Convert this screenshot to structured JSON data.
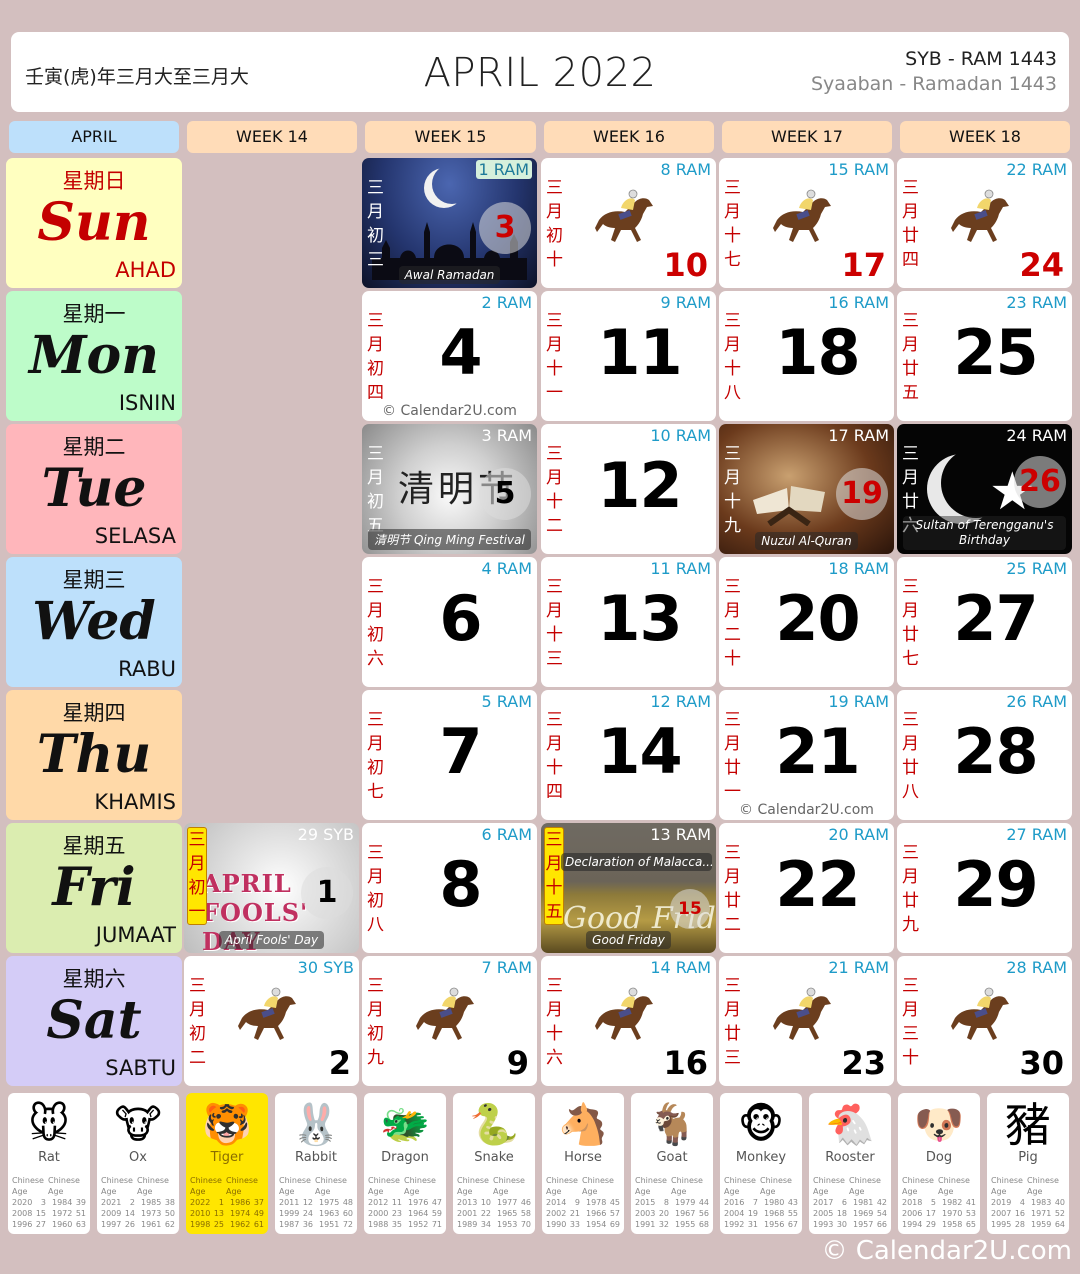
{
  "header": {
    "lunar_year": "壬寅(虎)年三月大至三月大",
    "title": "APRIL 2022",
    "hijri_short": "SYB - RAM 1443",
    "hijri_long": "Syaaban - Ramadan 1443"
  },
  "columns": [
    "APRIL",
    "WEEK 14",
    "WEEK 15",
    "WEEK 16",
    "WEEK 17",
    "WEEK 18"
  ],
  "days": [
    {
      "zh": "星期日",
      "en": "Sun",
      "ms": "AHAD",
      "bg": "#ffffc0"
    },
    {
      "zh": "星期一",
      "en": "Mon",
      "ms": "ISNIN",
      "bg": "#bdfcc9"
    },
    {
      "zh": "星期二",
      "en": "Tue",
      "ms": "SELASA",
      "bg": "#ffb6bb"
    },
    {
      "zh": "星期三",
      "en": "Wed",
      "ms": "RABU",
      "bg": "#bde0fb"
    },
    {
      "zh": "星期四",
      "en": "Thu",
      "ms": "KHAMIS",
      "bg": "#ffd9a8"
    },
    {
      "zh": "星期五",
      "en": "Fri",
      "ms": "JUMAAT",
      "bg": "#dbedb0"
    },
    {
      "zh": "星期六",
      "en": "Sat",
      "ms": "SABTU",
      "bg": "#d4ccf7"
    }
  ],
  "cells": {
    "d1": {
      "date": "1",
      "hijri": "29 SYB",
      "lunar": "三月初一",
      "event": "April Fools' Day",
      "art": "APRIL FOOLS' DAY"
    },
    "d2": {
      "date": "2",
      "hijri": "30 SYB",
      "lunar": "三月初二"
    },
    "d3": {
      "date": "3",
      "hijri": "1 RAM",
      "lunar": "三月初三",
      "event": "Awal Ramadan"
    },
    "d4": {
      "date": "4",
      "hijri": "2 RAM",
      "lunar": "三月初四",
      "watermark": "© Calendar2U.com"
    },
    "d5": {
      "date": "5",
      "hijri": "3 RAM",
      "lunar": "三月初五",
      "event": "清明节 Qing Ming Festival",
      "art": "清明节"
    },
    "d6": {
      "date": "6",
      "hijri": "4 RAM",
      "lunar": "三月初六"
    },
    "d7": {
      "date": "7",
      "hijri": "5 RAM",
      "lunar": "三月初七"
    },
    "d8": {
      "date": "8",
      "hijri": "6 RAM",
      "lunar": "三月初八"
    },
    "d9": {
      "date": "9",
      "hijri": "7 RAM",
      "lunar": "三月初九"
    },
    "d10": {
      "date": "10",
      "hijri": "8 RAM",
      "lunar": "三月初十"
    },
    "d11": {
      "date": "11",
      "hijri": "9 RAM",
      "lunar": "三月十一"
    },
    "d12": {
      "date": "12",
      "hijri": "10 RAM",
      "lunar": "三月十二"
    },
    "d13": {
      "date": "13",
      "hijri": "11 RAM",
      "lunar": "三月十三"
    },
    "d14": {
      "date": "14",
      "hijri": "12 RAM",
      "lunar": "三月十四"
    },
    "d15": {
      "date": "15",
      "hijri": "13 RAM",
      "lunar": "三月十五",
      "event": "Good Friday",
      "event2": "Declaration of Malacca...",
      "art": "Good Friday"
    },
    "d16": {
      "date": "16",
      "hijri": "14 RAM",
      "lunar": "三月十六"
    },
    "d17": {
      "date": "17",
      "hijri": "15 RAM",
      "lunar": "三月十七"
    },
    "d18": {
      "date": "18",
      "hijri": "16 RAM",
      "lunar": "三月十八"
    },
    "d19": {
      "date": "19",
      "hijri": "17 RAM",
      "lunar": "三月十九",
      "event": "Nuzul Al-Quran"
    },
    "d20": {
      "date": "20",
      "hijri": "18 RAM",
      "lunar": "三月二十"
    },
    "d21": {
      "date": "21",
      "hijri": "19 RAM",
      "lunar": "三月廿一",
      "watermark": "© Calendar2U.com"
    },
    "d22": {
      "date": "22",
      "hijri": "20 RAM",
      "lunar": "三月廿二"
    },
    "d23": {
      "date": "23",
      "hijri": "21 RAM",
      "lunar": "三月廿三"
    },
    "d24": {
      "date": "24",
      "hijri": "22 RAM",
      "lunar": "三月廿四"
    },
    "d25": {
      "date": "25",
      "hijri": "23 RAM",
      "lunar": "三月廿五"
    },
    "d26": {
      "date": "26",
      "hijri": "24 RAM",
      "lunar": "三月廿六",
      "event": "Sultan of Terengganu's Birthday"
    },
    "d27": {
      "date": "27",
      "hijri": "25 RAM",
      "lunar": "三月廿七"
    },
    "d28": {
      "date": "28",
      "hijri": "26 RAM",
      "lunar": "三月廿八"
    },
    "d29": {
      "date": "29",
      "hijri": "27 RAM",
      "lunar": "三月廿九"
    },
    "d30": {
      "date": "30",
      "hijri": "28 RAM",
      "lunar": "三月三十"
    }
  },
  "zodiac": {
    "col_headers": [
      "Chinese",
      "Age",
      "Chinese",
      "Age"
    ],
    "header_line1": [
      "Chinese",
      "Chinese"
    ],
    "header_line2": [
      "Age",
      "Age"
    ],
    "animals": [
      {
        "name": "Rat",
        "glyph": "🐭",
        "rows": [
          [
            "2020",
            "3",
            "1984",
            "39"
          ],
          [
            "2008",
            "15",
            "1972",
            "51"
          ],
          [
            "1996",
            "27",
            "1960",
            "63"
          ]
        ]
      },
      {
        "name": "Ox",
        "glyph": "🐮",
        "rows": [
          [
            "2021",
            "2",
            "1985",
            "38"
          ],
          [
            "2009",
            "14",
            "1973",
            "50"
          ],
          [
            "1997",
            "26",
            "1961",
            "62"
          ]
        ]
      },
      {
        "name": "Tiger",
        "glyph": "🐯",
        "highlight": true,
        "rows": [
          [
            "2022",
            "1",
            "1986",
            "37"
          ],
          [
            "2010",
            "13",
            "1974",
            "49"
          ],
          [
            "1998",
            "25",
            "1962",
            "61"
          ]
        ]
      },
      {
        "name": "Rabbit",
        "glyph": "🐰",
        "rows": [
          [
            "2011",
            "12",
            "1975",
            "48"
          ],
          [
            "1999",
            "24",
            "1963",
            "60"
          ],
          [
            "1987",
            "36",
            "1951",
            "72"
          ]
        ]
      },
      {
        "name": "Dragon",
        "glyph": "🐲",
        "rows": [
          [
            "2012",
            "11",
            "1976",
            "47"
          ],
          [
            "2000",
            "23",
            "1964",
            "59"
          ],
          [
            "1988",
            "35",
            "1952",
            "71"
          ]
        ]
      },
      {
        "name": "Snake",
        "glyph": "🐍",
        "rows": [
          [
            "2013",
            "10",
            "1977",
            "46"
          ],
          [
            "2001",
            "22",
            "1965",
            "58"
          ],
          [
            "1989",
            "34",
            "1953",
            "70"
          ]
        ]
      },
      {
        "name": "Horse",
        "glyph": "🐴",
        "rows": [
          [
            "2014",
            "9",
            "1978",
            "45"
          ],
          [
            "2002",
            "21",
            "1966",
            "57"
          ],
          [
            "1990",
            "33",
            "1954",
            "69"
          ]
        ]
      },
      {
        "name": "Goat",
        "glyph": "🐐",
        "rows": [
          [
            "2015",
            "8",
            "1979",
            "44"
          ],
          [
            "2003",
            "20",
            "1967",
            "56"
          ],
          [
            "1991",
            "32",
            "1955",
            "68"
          ]
        ]
      },
      {
        "name": "Monkey",
        "glyph": "🐵",
        "rows": [
          [
            "2016",
            "7",
            "1980",
            "43"
          ],
          [
            "2004",
            "19",
            "1968",
            "55"
          ],
          [
            "1992",
            "31",
            "1956",
            "67"
          ]
        ]
      },
      {
        "name": "Rooster",
        "glyph": "🐔",
        "rows": [
          [
            "2017",
            "6",
            "1981",
            "42"
          ],
          [
            "2005",
            "18",
            "1969",
            "54"
          ],
          [
            "1993",
            "30",
            "1957",
            "66"
          ]
        ]
      },
      {
        "name": "Dog",
        "glyph": "🐶",
        "rows": [
          [
            "2018",
            "5",
            "1982",
            "41"
          ],
          [
            "2006",
            "17",
            "1970",
            "53"
          ],
          [
            "1994",
            "29",
            "1958",
            "65"
          ]
        ]
      },
      {
        "name": "Pig",
        "glyph": "豬",
        "rows": [
          [
            "2019",
            "4",
            "1983",
            "40"
          ],
          [
            "2007",
            "16",
            "1971",
            "52"
          ],
          [
            "1995",
            "28",
            "1959",
            "64"
          ]
        ]
      }
    ]
  },
  "footer": "© Calendar2U.com",
  "colors": {
    "background": "#d3bfbf",
    "hijri_blue": "#1e9bc8",
    "holiday_red": "#cc0000",
    "lunar_red": "#c40000",
    "week_header": "#ffdcb8",
    "month_header": "#bde0fb",
    "highlight_yellow": "#ffe600"
  }
}
